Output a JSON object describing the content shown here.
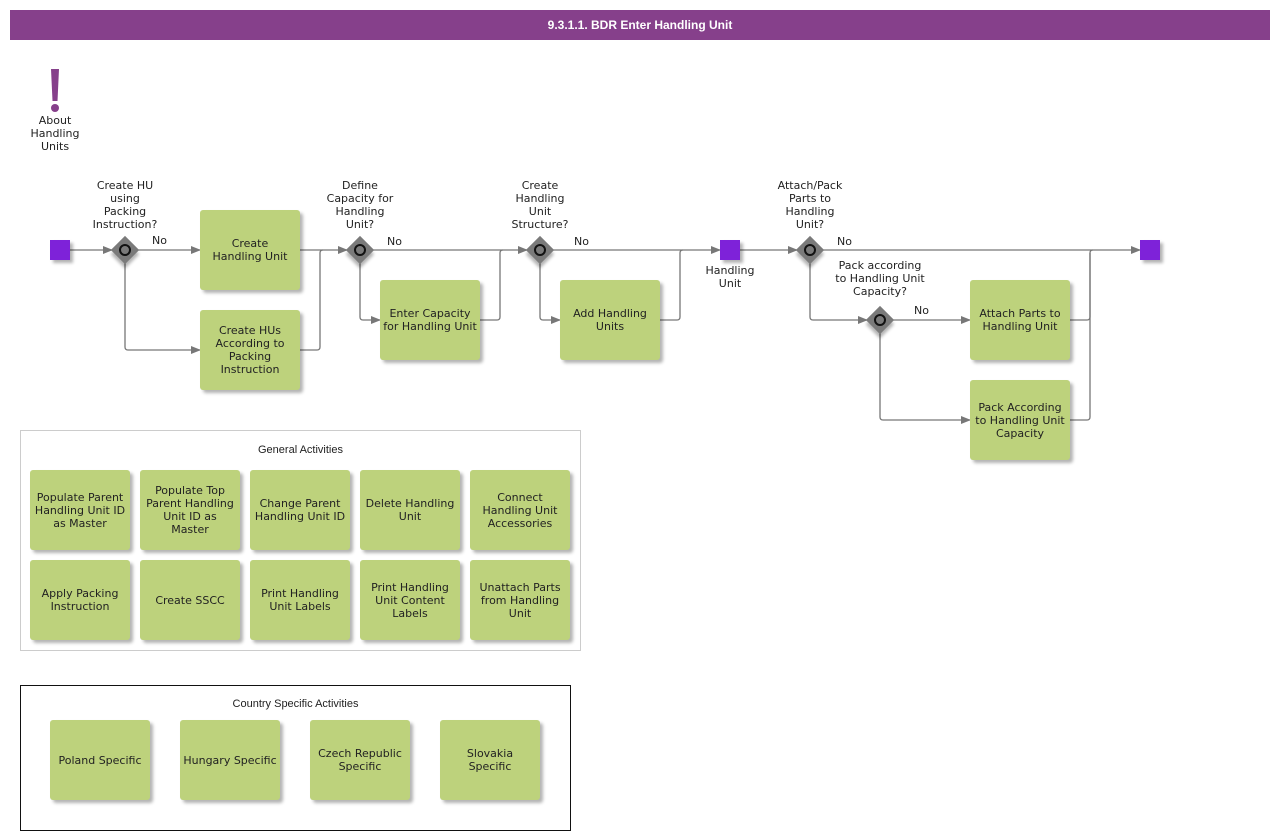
{
  "title": "9.3.1.1. BDR Enter Handling Unit",
  "about": {
    "icon": "exclamation-icon",
    "label": "About\nHandling\nUnits"
  },
  "colors": {
    "header": "#86408b",
    "task": "#bdd27c",
    "event": "#7e22d9",
    "gateway": "#7a7a7a"
  },
  "gateways": [
    {
      "id": "gw1",
      "question": "Create HU\nusing\nPacking\nInstruction?",
      "no_label": "No"
    },
    {
      "id": "gw2",
      "question": "Define\nCapacity for\nHandling\nUnit?",
      "no_label": "No"
    },
    {
      "id": "gw3",
      "question": "Create\nHandling\nUnit\nStructure?",
      "no_label": "No"
    },
    {
      "id": "gw4",
      "question": "Attach/Pack\nParts to\nHandling\nUnit?",
      "no_label": "No"
    },
    {
      "id": "gw5",
      "question": "Pack according\nto Handling Unit\nCapacity?",
      "no_label": "No"
    }
  ],
  "tasks": {
    "create_hu": "Create\nHandling Unit",
    "create_hus_pi": "Create HUs\nAccording to\nPacking\nInstruction",
    "enter_capacity": "Enter Capacity\nfor Handling Unit",
    "add_hus": "Add Handling\nUnits",
    "attach_parts": "Attach Parts to\nHandling Unit",
    "pack_capacity": "Pack According\nto Handling Unit\nCapacity"
  },
  "events": {
    "intermediate_label": "Handling\nUnit"
  },
  "general": {
    "title": "General Activities",
    "items": [
      "Populate Parent\nHandling Unit ID\nas Master",
      "Populate Top\nParent Handling\nUnit ID as\nMaster",
      "Change Parent\nHandling Unit ID",
      "Delete Handling\nUnit",
      "Connect\nHandling Unit\nAccessories",
      "Apply Packing\nInstruction",
      "Create SSCC",
      "Print Handling\nUnit Labels",
      "Print Handling\nUnit Content\nLabels",
      "Unattach Parts\nfrom Handling\nUnit"
    ]
  },
  "country": {
    "title": "Country Specific Activities",
    "items": [
      "Poland Specific",
      "Hungary Specific",
      "Czech Republic\nSpecific",
      "Slovakia\nSpecific"
    ]
  }
}
